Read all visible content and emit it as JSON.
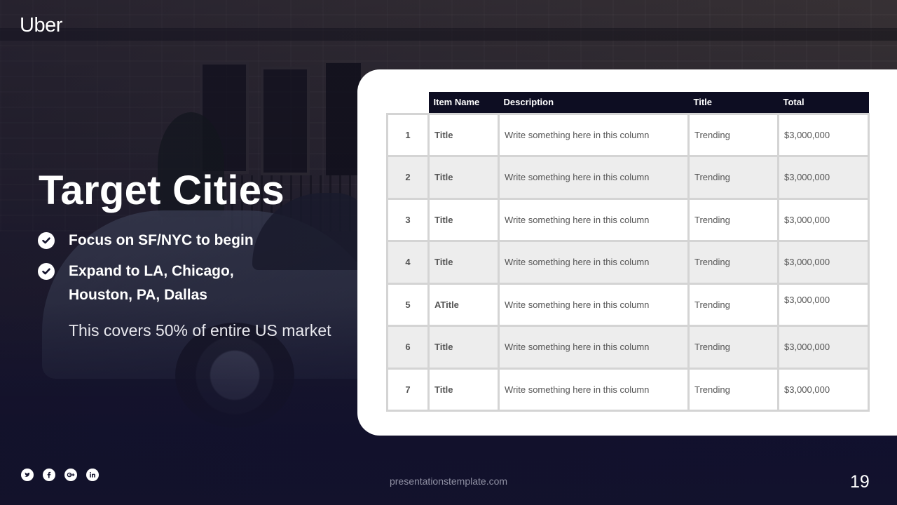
{
  "brand": {
    "logo_text": "Uber"
  },
  "slide": {
    "title": "Target Cities",
    "bullets": [
      {
        "text": "Focus on SF/NYC to begin"
      },
      {
        "text_line1": "Expand to LA, Chicago,",
        "text_line2": "Houston, PA, Dallas"
      }
    ],
    "note": "This covers 50% of entire US market"
  },
  "table": {
    "headers": [
      "Item Name",
      "Description",
      "Title",
      "Total"
    ],
    "rows": [
      {
        "num": "1",
        "item": "Title",
        "description": "Write something here in this column",
        "title": "Trending",
        "total": "$3,000,000"
      },
      {
        "num": "2",
        "item": "Title",
        "description": "Write something here in this column",
        "title": "Trending",
        "total": "$3,000,000"
      },
      {
        "num": "3",
        "item": "Title",
        "description": "Write something here in this column",
        "title": "Trending",
        "total": "$3,000,000"
      },
      {
        "num": "4",
        "item": "Title",
        "description": "Write something here in this column",
        "title": "Trending",
        "total": "$3,000,000"
      },
      {
        "num": "5",
        "item": "ATitle",
        "description": "Write something here in this column",
        "title": "Trending",
        "total": "$3,000,000"
      },
      {
        "num": "6",
        "item": "Title",
        "description": "Write something here in this column",
        "title": "Trending",
        "total": "$3,000,000"
      },
      {
        "num": "7",
        "item": "Title",
        "description": "Write something here in this column",
        "title": "Trending",
        "total": "$3,000,000"
      }
    ]
  },
  "footer": {
    "social_icons": [
      "twitter-icon",
      "facebook-icon",
      "google-plus-icon",
      "linkedin-icon"
    ],
    "url": "presentationstemplate.com",
    "page_number": "19"
  },
  "colors": {
    "header_bg": "#0d0d22",
    "card_bg": "#ffffff",
    "row_alt": "#ededed",
    "footer_text": "#8f90a3"
  }
}
